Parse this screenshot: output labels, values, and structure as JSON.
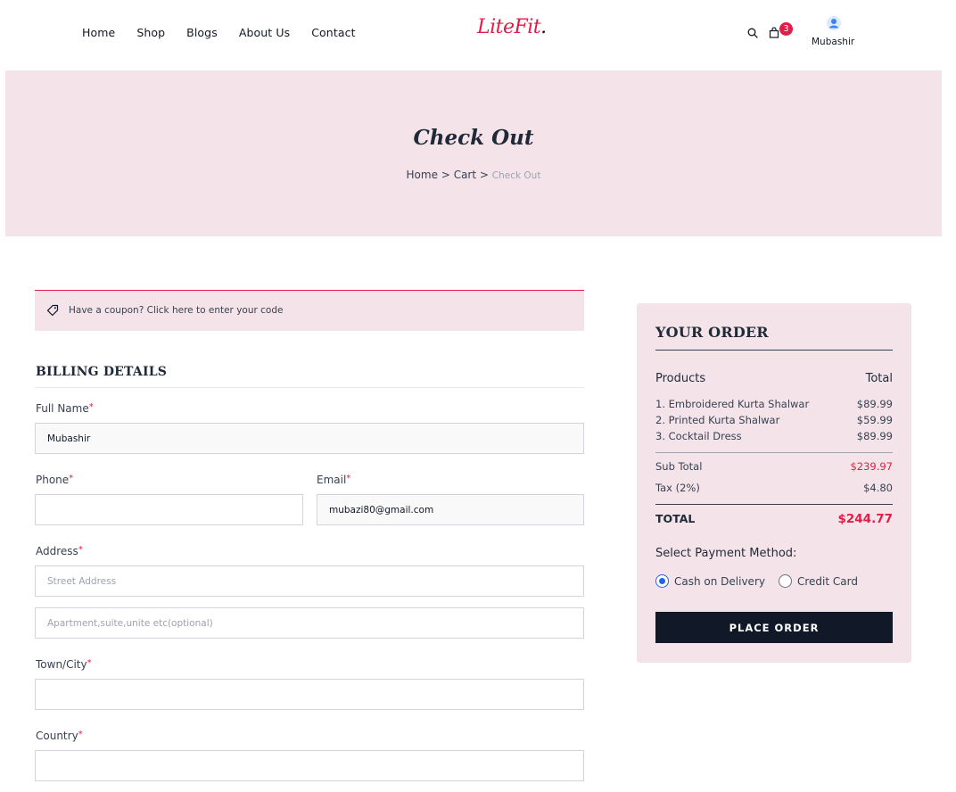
{
  "header": {
    "nav": [
      "Home",
      "Shop",
      "Blogs",
      "About Us",
      "Contact"
    ],
    "logo_main": "LiteFit",
    "logo_dot": ".",
    "cart_count": "3",
    "user_name": "Mubashir",
    "icons": [
      "search-icon",
      "cart-icon",
      "user-avatar-icon"
    ]
  },
  "banner": {
    "title": "Check Out",
    "breadcrumb": [
      "Home",
      "Cart",
      "Check Out"
    ],
    "separator": ">"
  },
  "coupon": {
    "text": "Have a coupon? Click here to enter your code",
    "icon": "tag-icon"
  },
  "billing": {
    "title": "BILLING DETAILS",
    "required_mark": "*",
    "full_name": {
      "label": "Full Name",
      "value": "Mubashir"
    },
    "phone": {
      "label": "Phone",
      "value": ""
    },
    "email": {
      "label": "Email",
      "value": "mubazi80@gmail.com"
    },
    "address": {
      "label": "Address",
      "placeholder1": "Street Address",
      "placeholder2": "Apartment,suite,unite etc(optional)"
    },
    "town": {
      "label": "Town/City",
      "value": ""
    },
    "country": {
      "label": "Country",
      "value": ""
    }
  },
  "order": {
    "title": "YOUR ORDER",
    "col_products": "Products",
    "col_total": "Total",
    "items": [
      {
        "name": "1. Embroidered Kurta Shalwar",
        "price": "$89.99"
      },
      {
        "name": "2. Printed Kurta Shalwar",
        "price": "$59.99"
      },
      {
        "name": "3. Cocktail Dress",
        "price": "$89.99"
      }
    ],
    "subtotal_label": "Sub Total",
    "subtotal_value": "$239.97",
    "tax_label": "Tax (2%)",
    "tax_value": "$4.80",
    "total_label": "TOTAL",
    "total_value": "$244.77",
    "payment_title": "Select Payment Method:",
    "payment_options": [
      "Cash on Delivery",
      "Credit Card"
    ],
    "payment_selected": "Cash on Delivery",
    "place_order": "PLACE ORDER"
  },
  "colors": {
    "accent": "#e11d48",
    "panel": "#f4e4ea",
    "button": "#111827",
    "radio": "#2563eb"
  }
}
